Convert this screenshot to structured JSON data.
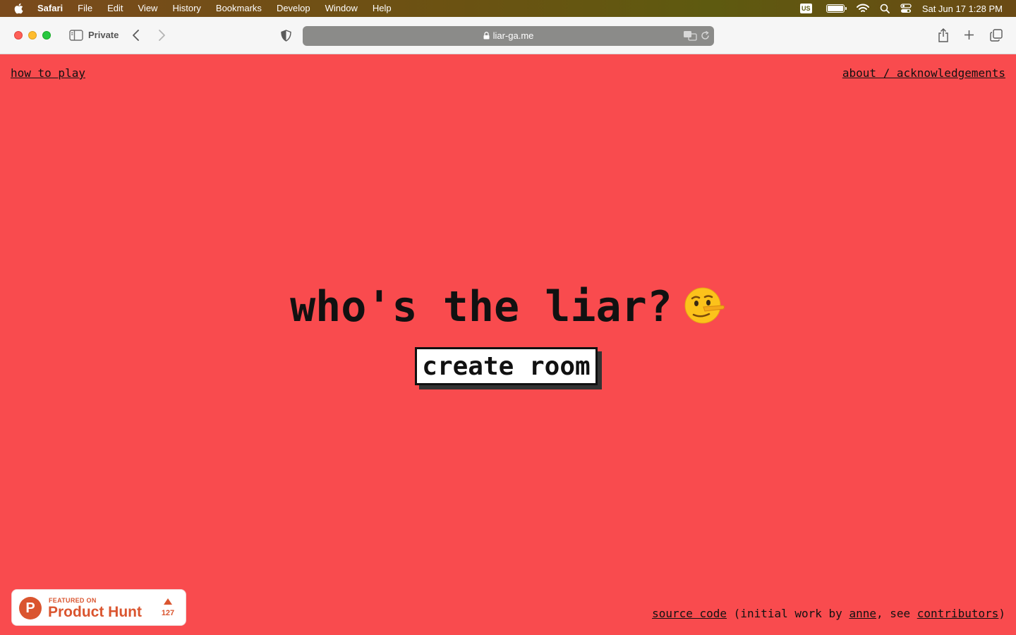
{
  "menubar": {
    "app_name": "Safari",
    "menus": [
      "File",
      "Edit",
      "View",
      "History",
      "Bookmarks",
      "Develop",
      "Window",
      "Help"
    ],
    "input_source": "US",
    "clock": "Sat Jun 17  1:28 PM"
  },
  "toolbar": {
    "private_label": "Private",
    "url": "liar-ga.me"
  },
  "page": {
    "how_to_play": "how to play",
    "about": "about / acknowledgements",
    "title": "who's the liar?",
    "title_emoji": "lying-face",
    "create_room": "create room",
    "footer": {
      "source_code": "source code",
      "text_1": " (initial work by ",
      "anne": "anne",
      "text_2": ", see ",
      "contributors": "contributors",
      "text_3": ")"
    }
  },
  "product_hunt": {
    "logo_letter": "P",
    "featured": "FEATURED ON",
    "name": "Product Hunt",
    "votes": "127"
  },
  "colors": {
    "background": "#f94b4e",
    "product_hunt": "#da552f"
  }
}
